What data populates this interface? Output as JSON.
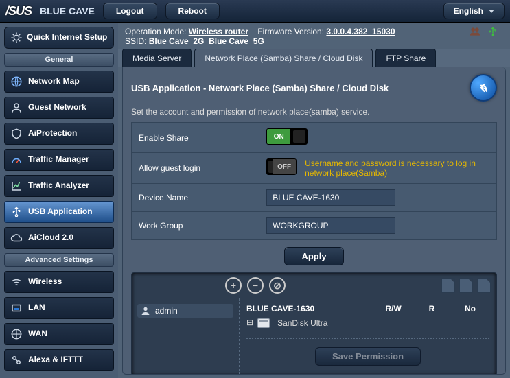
{
  "brand": "/SUS",
  "product": "BLUE CAVE",
  "topbar": {
    "logout": "Logout",
    "reboot": "Reboot",
    "language": "English"
  },
  "info": {
    "op_mode_label": "Operation Mode:",
    "op_mode": "Wireless router",
    "fw_label": "Firmware Version:",
    "fw": "3.0.0.4.382_15030",
    "ssid_label": "SSID:",
    "ssid1": "Blue Cave_2G",
    "ssid2": "Blue Cave_5G"
  },
  "sidebar": {
    "qis": "Quick Internet Setup",
    "general_hdr": "General",
    "items": [
      "Network Map",
      "Guest Network",
      "AiProtection",
      "Traffic Manager",
      "Traffic Analyzer",
      "USB Application",
      "AiCloud 2.0"
    ],
    "adv_hdr": "Advanced Settings",
    "adv_items": [
      "Wireless",
      "LAN",
      "WAN",
      "Alexa & IFTTT"
    ]
  },
  "tabs": {
    "media": "Media Server",
    "samba": "Network Place (Samba) Share / Cloud Disk",
    "ftp": "FTP Share"
  },
  "panel": {
    "title": "USB Application - Network Place (Samba) Share / Cloud Disk",
    "desc": "Set the account and permission of network place(samba) service.",
    "enable_share_label": "Enable Share",
    "on_label": "ON",
    "allow_guest_label": "Allow guest login",
    "off_label": "OFF",
    "guest_hint": "Username and password is necessary to log in network place(Samba)",
    "device_name_label": "Device Name",
    "device_name_value": "BLUE CAVE-1630",
    "workgroup_label": "Work Group",
    "workgroup_value": "WORKGROUP",
    "apply": "Apply"
  },
  "perm": {
    "user": "admin",
    "share_name": "BLUE CAVE-1630",
    "disk_name": "SanDisk Ultra",
    "col_rw": "R/W",
    "col_r": "R",
    "col_no": "No",
    "save": "Save Permission"
  }
}
